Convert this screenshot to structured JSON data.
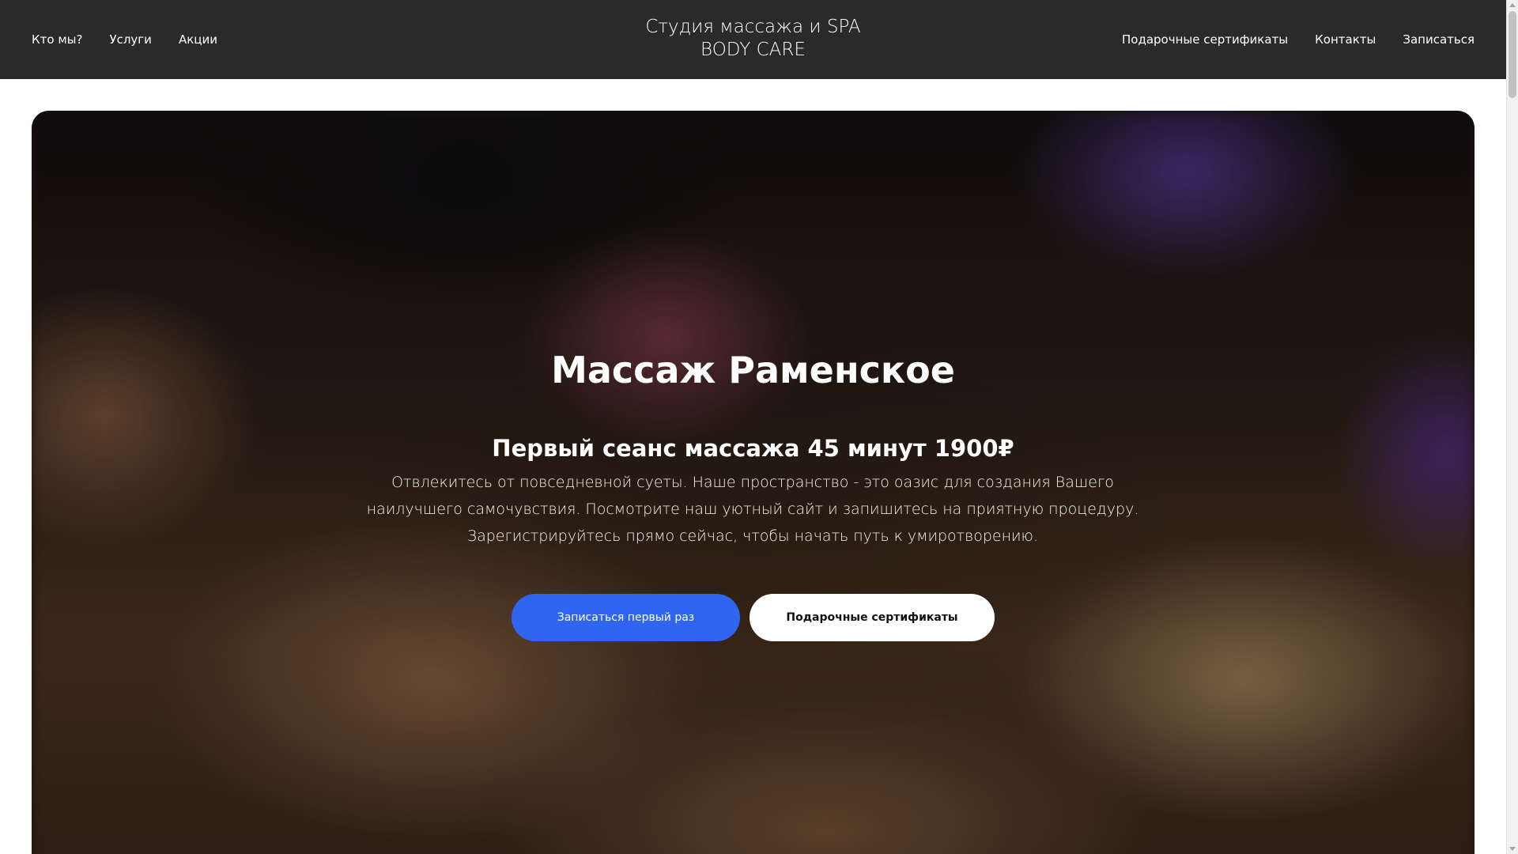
{
  "header": {
    "nav_left": [
      "Кто мы?",
      "Услуги",
      "Акции"
    ],
    "brand_line1": "Студия массажа и SPA",
    "brand_line2": "BODY CARE",
    "nav_right": [
      "Подарочные сертификаты",
      "Контакты",
      "Записаться"
    ]
  },
  "hero": {
    "title": "Массаж Раменское",
    "subtitle": "Первый сеанс массажа 45 минут 1900₽",
    "text": "Отвлекитесь от повседневной суеты. Наше пространство - это оазис для создания Вашего наилучшего самочувствия. Посмотрите наш уютный сайт и запишитесь на приятную процедуру. Зарегистрируйтесь прямо сейчас, чтобы начать путь к умиротворению.",
    "primary_button": "Записаться первый раз",
    "secondary_button": "Подарочные сертификаты"
  },
  "colors": {
    "header_bg": "#2a2a2a",
    "accent_blue": "#3065f0",
    "page_bg": "#ffffff"
  }
}
